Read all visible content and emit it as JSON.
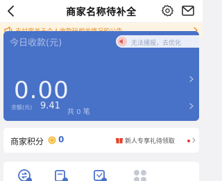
{
  "header": {
    "title": "商家名称待补全",
    "back_icon": "chevron-left-icon",
    "settings_icon": "gear-icon",
    "message_icon": "mail-icon"
  },
  "notice": {
    "text": "支付宝关于个人收款码相关情况的公告",
    "icon": "speaker-icon",
    "color": "#e28a1f",
    "background": "#fdf4e3"
  },
  "income_card": {
    "label": "今日收款(元)",
    "voice_status": "无法播报，去优化",
    "amount": "0.00",
    "transactions": "共 0 笔",
    "balance_label": "余额(元)",
    "balance_value": "9.41",
    "background": "#4871c8"
  },
  "points": {
    "label": "商家积分",
    "value": "0",
    "gift_text": "新人专享礼待领取",
    "value_color": "#4469c2"
  },
  "tools": {
    "icons": [
      "transfer-icon",
      "bill-icon",
      "receipt-icon",
      "more-apps-icon"
    ]
  }
}
